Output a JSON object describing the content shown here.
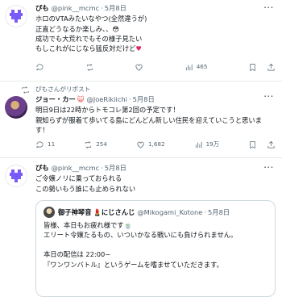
{
  "tweet1": {
    "name": "ぴも",
    "handle": "@pink__mcmc",
    "dot": "·",
    "date": "5月8日",
    "lines": [
      "ホロのVTAみたいなやつ(全然違うが)",
      "正直どうなるか楽しみ、、😳",
      "成功でも大荒れでもその様子見たい"
    ],
    "last_line": "もしこれがにじなら猛反対だけど",
    "heart": "♥",
    "views": "465"
  },
  "tweet2": {
    "retweet_by": "ぴもさんがリポスト",
    "name": "ジョー・カー",
    "badge": "😺",
    "handle": "@JoeRikiichi",
    "dot": "·",
    "date": "5月8日",
    "lines": [
      "明日9日は22時からトモコレ第2回の予定です！",
      "親知らずが服着て歩いてる島にどんどん新しい住民を迎えていこうと思いま",
      "す！"
    ],
    "replies": "11",
    "retweets": "254",
    "likes": "1,682",
    "views": "19万"
  },
  "tweet3": {
    "name": "ぴも",
    "handle": "@pink__mcmc",
    "dot": "·",
    "date": "5月8日",
    "lines": [
      "ご令嬢ノリに乗っておられる",
      "この勢いもう誰にも止められない"
    ],
    "quote": {
      "name": "御子神琴音",
      "name_suffix": "にじさんじ",
      "handle": "@Mikogami_Kotone",
      "dot": "·",
      "date": "5月8日",
      "lines": [
        "皆様、本日もお疲れ様です🍵",
        "エリート令嬢たるもの、いついかなる戦いにも負けられません。",
        "",
        "本日の配信は 22:00~",
        "『ワンワンバトル』というゲームを嗜ませていただきます。"
      ]
    }
  },
  "more_label": "···"
}
